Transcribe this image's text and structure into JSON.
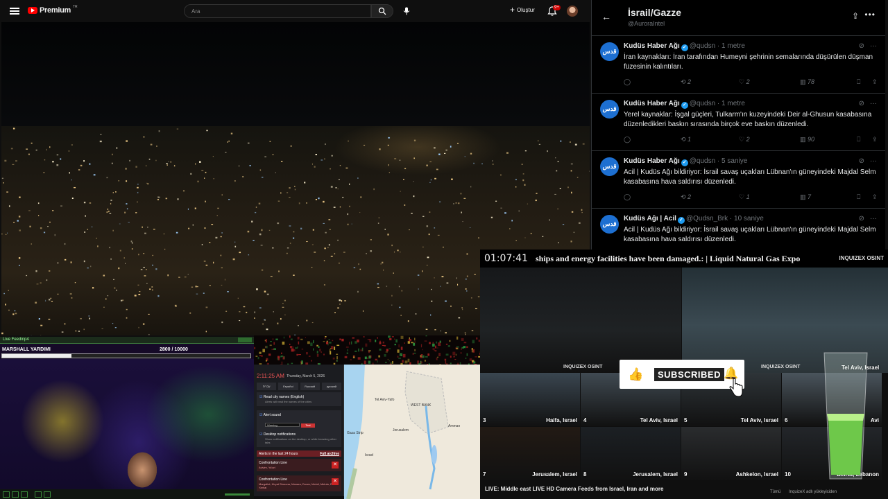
{
  "youtube": {
    "logo_text": "Premium",
    "region": "TR",
    "search_placeholder": "Ara",
    "create_label": "Oluştur",
    "notification_count": "9+"
  },
  "twitter": {
    "title": "İsrail/Gazze",
    "handle": "@AuroraIntel",
    "tweets": [
      {
        "avatar_text": "قدس",
        "name": "Kudüs Haber Ağı",
        "handle": "@qudsn",
        "time": "1 metre",
        "text": "İran kaynakları: İran tarafından Humeyni şehrinin semalarında düşürülen düşman füzesinin kalıntıları.",
        "replies": "",
        "retweets": "2",
        "likes": "2",
        "views": "78"
      },
      {
        "avatar_text": "قدس",
        "name": "Kudüs Haber Ağı",
        "handle": "@qudsn",
        "time": "1 metre",
        "text": "Yerel kaynaklar: İşgal güçleri, Tulkarm'ın kuzeyindeki Deir al-Ghusun kasabasına düzenledikleri baskın sırasında birçok eve baskın düzenledi.",
        "replies": "",
        "retweets": "1",
        "likes": "2",
        "views": "90"
      },
      {
        "avatar_text": "قدس",
        "name": "Kudüs Haber Ağı",
        "handle": "@qudsn",
        "time": "5 saniye",
        "text": "Acil | Kudüs Ağı bildiriyor: İsrail savaş uçakları Lübnan'ın güneyindeki Majdal Selm kasabasına hava saldırısı düzenledi.",
        "replies": "",
        "retweets": "2",
        "likes": "1",
        "views": "7"
      },
      {
        "avatar_text": "قدس",
        "name": "Kudüs Ağı | Acil",
        "handle": "@Qudsn_Brk",
        "time": "10 saniye",
        "text": "Acil | Kudüs Ağı bildiriyor: İsrail savaş uçakları Lübnan'ın güneyindeki Majdal Selm kasabasına hava saldırısı düzenledi.",
        "replies": "",
        "retweets": "",
        "likes": "",
        "views": ""
      }
    ]
  },
  "overlay": {
    "clock": "01:07:41",
    "ticker": "ships and energy facilities have been damaged.:     |     Liquid Natural Gas Expo",
    "brand": "INQUIZEX OSINT",
    "cam_logo": "INQUIZEX OSINT",
    "cam_main_label": "Tel Aviv, Israel",
    "cams": [
      {
        "num": "3",
        "label": "Haifa, Israel"
      },
      {
        "num": "4",
        "label": "Tel Aviv, Israel"
      },
      {
        "num": "5",
        "label": "Tel Aviv, Israel"
      },
      {
        "num": "6",
        "label": "Avi"
      },
      {
        "num": "7",
        "label": "Jerusalem, Israel"
      },
      {
        "num": "8",
        "label": "Jerusalem, Israel"
      },
      {
        "num": "9",
        "label": "Ashkelon, Israel"
      },
      {
        "num": "10",
        "label": "Beirut, Lebanon"
      }
    ],
    "subscribe_label": "SUBSCRIBED",
    "video_title": "LIVE: Middle east LIVE HD Camera Feeds from Israel, Iran and more",
    "bottom_small_1": "Tümü",
    "bottom_small_2": "InquizeX adlı yükleyiciden"
  },
  "livefeed": {
    "title": "Live Feedinp4",
    "boss_name": "MARSHALL YARDIMI",
    "hp_text": "2800  /  10000",
    "hp_fraction": 0.28
  },
  "alert_app": {
    "time": "2:11:25 AM",
    "date": "Thursday, March 5, 2026",
    "languages": [
      "עברית",
      "Español",
      "Русский",
      "русский"
    ],
    "read_names_label": "Read city names (English)",
    "read_names_sub": "Alerts will read the names of the cities",
    "alert_sound_label": "Alert sound",
    "sound_value": "Warning",
    "test_label": "Test",
    "desktop_label": "Desktop notifications",
    "desktop_sub": "Show notifications on the desktop, or while browsing other tabs",
    "alerts_head": "Alerts in the last 24 hours",
    "full_archive": "Full archive",
    "alerts": [
      {
        "title": "Confrontation Line",
        "sub": "Avivim, Ya'ari"
      },
      {
        "title": "Confrontation Line",
        "sub": "Margaliot, Kiryat Shmona, Manara, Dovev, Ma'ali, Metula, Rafael Yarhal"
      }
    ]
  },
  "map": {
    "labels": [
      "Tel Aviv-Yafo",
      "Jerusalem",
      "WEST BANK",
      "Israel",
      "Gaza Strip",
      "Amman"
    ]
  }
}
